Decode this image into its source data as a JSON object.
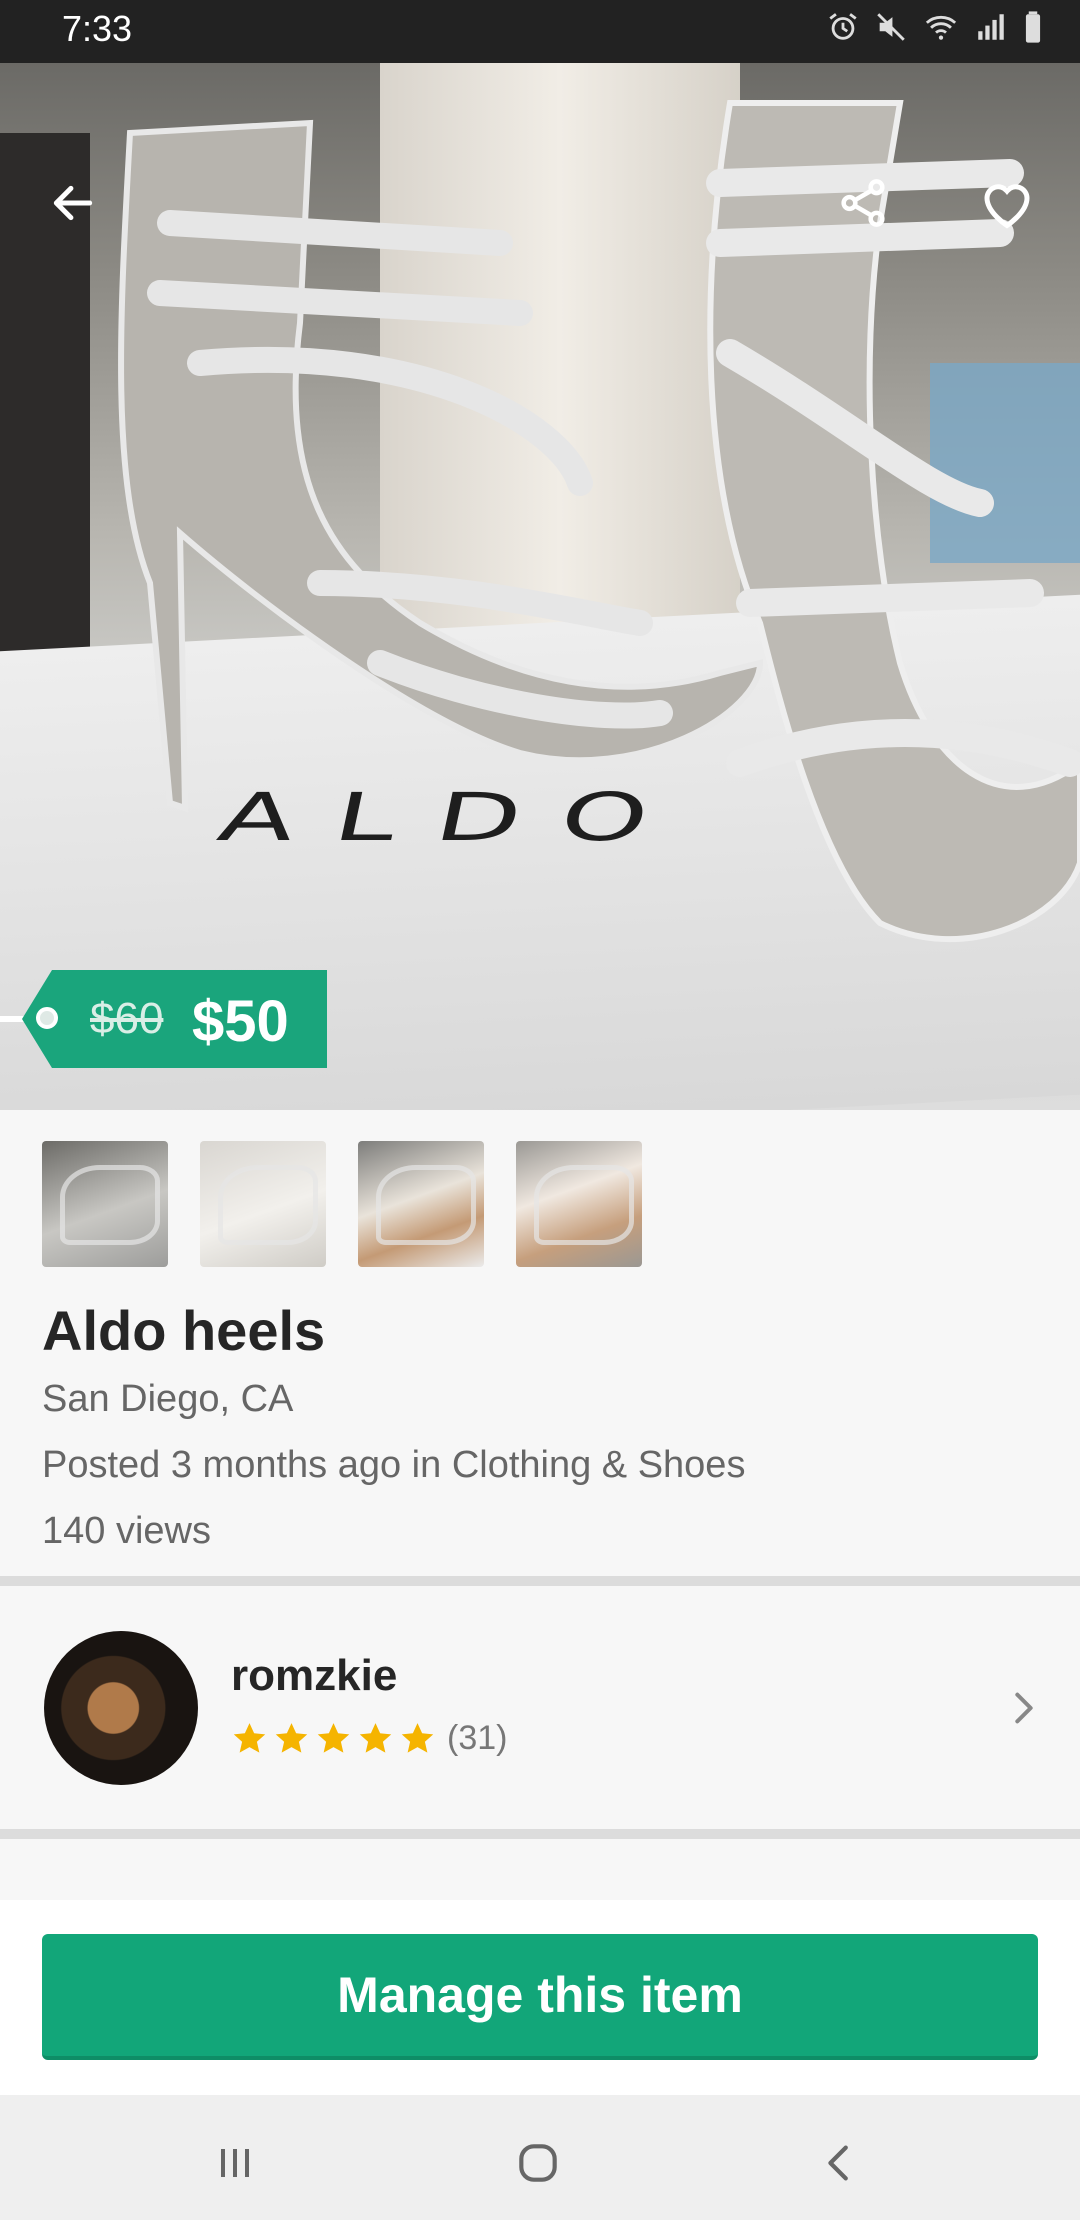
{
  "status_bar": {
    "time": "7:33",
    "icons": [
      "alarm-icon",
      "mute-icon",
      "wifi-icon",
      "signal-icon",
      "battery-icon"
    ]
  },
  "hero": {
    "image": "product-photo-silver-heels",
    "brand_text_on_box": "ALDO",
    "top_icons": [
      "back-arrow-icon",
      "share-icon",
      "heart-icon"
    ],
    "price": {
      "original": "$60",
      "current": "$50"
    }
  },
  "thumbnails": [
    "thumbnail-1",
    "thumbnail-2",
    "thumbnail-3",
    "thumbnail-4"
  ],
  "listing": {
    "title": "Aldo heels",
    "location": "San Diego, CA",
    "posted": "Posted 3 months ago in Clothing & Shoes",
    "views": "140 views"
  },
  "seller": {
    "name": "romzkie",
    "rating_stars": 5,
    "rating_count": "(31)"
  },
  "actions": {
    "manage_label": "Manage this item"
  },
  "colors": {
    "accent": "#12a679",
    "price_tag": "#1aa57c",
    "star": "#f5b400",
    "status_bar": "#222222"
  },
  "nav_bar": [
    "recent-apps-icon",
    "home-icon",
    "back-icon"
  ]
}
